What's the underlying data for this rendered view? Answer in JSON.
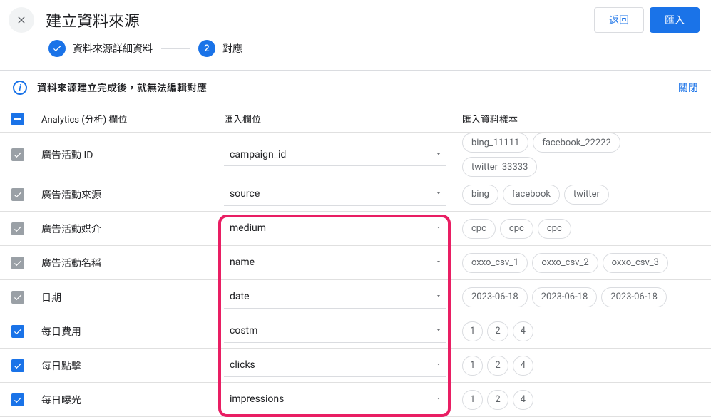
{
  "header": {
    "title": "建立資料來源",
    "back_label": "返回",
    "import_label": "匯入"
  },
  "stepper": {
    "step1_label": "資料來源詳細資料",
    "step2_number": "2",
    "step2_label": "對應"
  },
  "info": {
    "message": "資料來源建立完成後，就無法編輯對應",
    "close_label": "關閉"
  },
  "columns": {
    "analytics": "Analytics (分析) 欄位",
    "import": "匯入欄位",
    "sample": "匯入資料樣本"
  },
  "rows": [
    {
      "checked": true,
      "check_style": "gray",
      "analytics": "廣告活動 ID",
      "import_field": "campaign_id",
      "sample": [
        "bing_11111",
        "facebook_22222",
        "twitter_33333"
      ]
    },
    {
      "checked": true,
      "check_style": "gray",
      "analytics": "廣告活動來源",
      "import_field": "source",
      "sample": [
        "bing",
        "facebook",
        "twitter"
      ]
    },
    {
      "checked": true,
      "check_style": "gray",
      "analytics": "廣告活動媒介",
      "import_field": "medium",
      "sample": [
        "cpc",
        "cpc",
        "cpc"
      ]
    },
    {
      "checked": true,
      "check_style": "gray",
      "analytics": "廣告活動名稱",
      "import_field": "name",
      "sample": [
        "oxxo_csv_1",
        "oxxo_csv_2",
        "oxxo_csv_3"
      ]
    },
    {
      "checked": true,
      "check_style": "gray",
      "analytics": "日期",
      "import_field": "date",
      "sample": [
        "2023-06-18",
        "2023-06-18",
        "2023-06-18"
      ]
    },
    {
      "checked": true,
      "check_style": "blue",
      "analytics": "每日費用",
      "import_field": "costm",
      "sample": [
        "1",
        "2",
        "4"
      ]
    },
    {
      "checked": true,
      "check_style": "blue",
      "analytics": "每日點擊",
      "import_field": "clicks",
      "sample": [
        "1",
        "2",
        "4"
      ]
    },
    {
      "checked": true,
      "check_style": "blue",
      "analytics": "每日曝光",
      "import_field": "impressions",
      "sample": [
        "1",
        "2",
        "4"
      ]
    }
  ]
}
